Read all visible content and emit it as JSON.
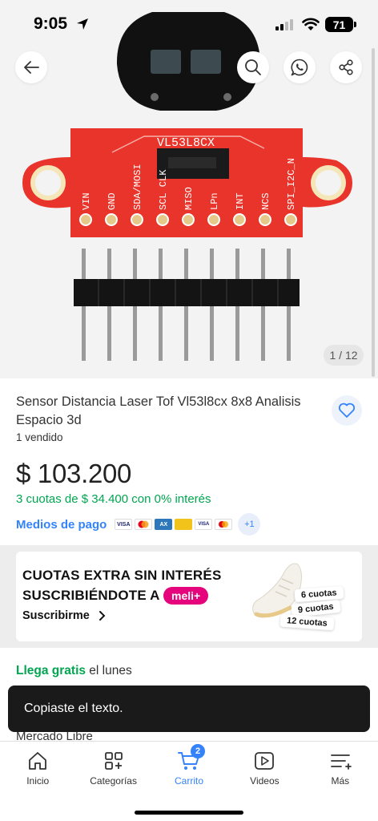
{
  "status_bar": {
    "time": "9:05",
    "battery": "71"
  },
  "gallery": {
    "counter": "1 / 12"
  },
  "product_image_text": {
    "chip": "VL53L8CX",
    "pins": [
      "VIN",
      "GND",
      "SDA/MOSI",
      "SCL CLK",
      "MISO",
      "LPn",
      "INT",
      "NCS",
      "SPI_I2C_N"
    ]
  },
  "product": {
    "title": "Sensor Distancia Laser Tof Vl53l8cx 8x8 Analisis Espacio 3d",
    "sold": "1 vendido",
    "price": "$ 103.200",
    "installments": "3 cuotas de $ 34.400 con 0% interés",
    "payment_link": "Medios de pago",
    "payment_more": "+1"
  },
  "promo": {
    "line1": "CUOTAS EXTRA SIN INTERÉS",
    "line2": "SUSCRIBIÉNDOTE A",
    "badge": "meli+",
    "cta": "Suscribirme",
    "tags": [
      "6 cuotas",
      "9 cuotas",
      "12 cuotas"
    ]
  },
  "shipping": {
    "free": "Llega gratis",
    "day": " el lunes",
    "seller": "Mercado Libre"
  },
  "toast": {
    "message": "Copiaste el texto."
  },
  "nav": {
    "items": [
      {
        "label": "Inicio",
        "icon": "home-icon"
      },
      {
        "label": "Categorías",
        "icon": "grid-icon"
      },
      {
        "label": "Carrito",
        "icon": "cart-icon",
        "badge": "2"
      },
      {
        "label": "Videos",
        "icon": "play-icon"
      },
      {
        "label": "Más",
        "icon": "menu-icon"
      }
    ]
  },
  "colors": {
    "accent": "#3483fa",
    "green": "#00a650",
    "pcb": "#e8342a",
    "meli_pink": "#e6047c"
  }
}
